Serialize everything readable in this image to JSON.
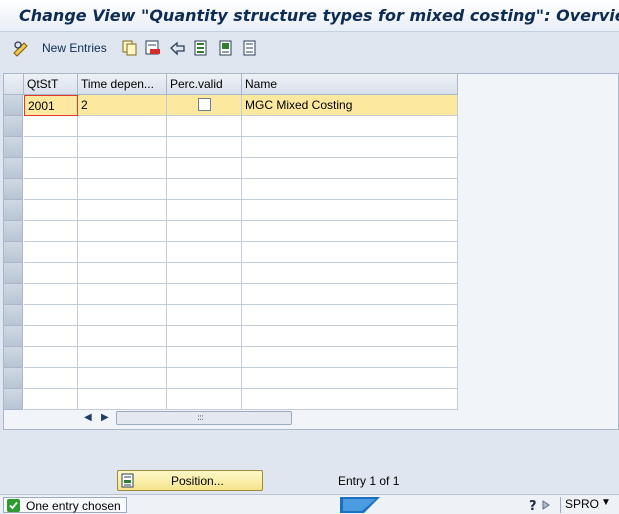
{
  "window": {
    "title": "Change View \"Quantity structure types for mixed costing\": Overview"
  },
  "toolbar": {
    "new_entries_label": "New Entries",
    "icons": [
      "glasses-pencil-icon",
      "copy-icon",
      "delete-icon",
      "undo-icon",
      "select-all-icon",
      "select-block-icon",
      "deselect-all-icon"
    ]
  },
  "table": {
    "columns": [
      "QtStT",
      "Time depen...",
      "Perc.valid",
      "Name"
    ],
    "rows": [
      {
        "qtstt": "2001",
        "time_dependent": "2",
        "perc_valid": false,
        "name": "MGC Mixed Costing"
      }
    ],
    "empty_rows": 14
  },
  "footer": {
    "position_button_label": "Position...",
    "entry_info": "Entry 1 of 1"
  },
  "statusbar": {
    "message": "One entry chosen",
    "system": "SPRO"
  },
  "colors": {
    "title": "#0d2c54",
    "selected_row": "#fde8a0",
    "button": "#f4e48c",
    "status_ok": "#2f9a2f"
  }
}
